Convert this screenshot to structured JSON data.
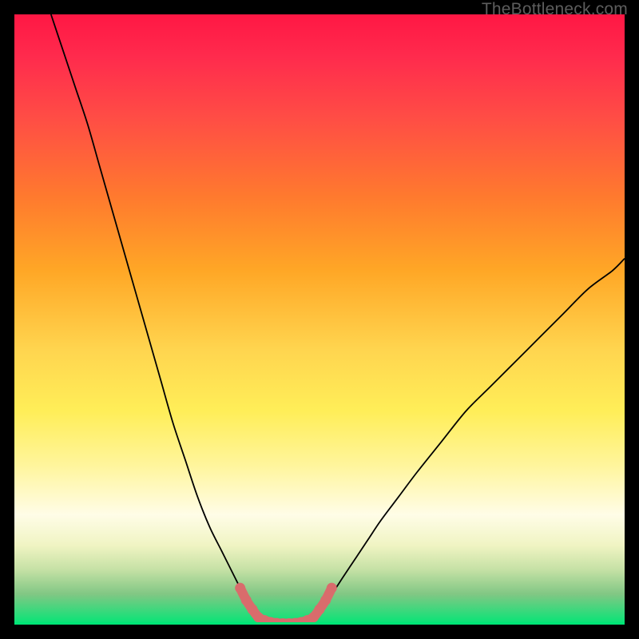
{
  "watermark": "TheBottleneck.com",
  "chart_data": {
    "type": "line",
    "title": "",
    "xlabel": "",
    "ylabel": "",
    "xlim": [
      0,
      100
    ],
    "ylim": [
      0,
      100
    ],
    "series": [
      {
        "name": "left-curve",
        "x": [
          6,
          8,
          10,
          12,
          14,
          16,
          18,
          20,
          22,
          24,
          26,
          28,
          30,
          32,
          34,
          36,
          37,
          38,
          39,
          40
        ],
        "values": [
          100,
          94,
          88,
          82,
          75,
          68,
          61,
          54,
          47,
          40,
          33,
          27,
          21,
          16,
          12,
          8,
          6,
          4,
          2.5,
          1.2
        ]
      },
      {
        "name": "bottom-segment",
        "x": [
          40,
          41,
          42,
          43,
          44,
          45,
          46,
          47,
          48,
          49
        ],
        "values": [
          1.2,
          0.7,
          0.4,
          0.25,
          0.2,
          0.2,
          0.25,
          0.4,
          0.7,
          1.2
        ]
      },
      {
        "name": "right-curve",
        "x": [
          49,
          50,
          52,
          54,
          56,
          58,
          60,
          63,
          66,
          70,
          74,
          78,
          82,
          86,
          90,
          94,
          98,
          100
        ],
        "values": [
          1.2,
          2.5,
          5,
          8,
          11,
          14,
          17,
          21,
          25,
          30,
          35,
          39,
          43,
          47,
          51,
          55,
          58,
          60
        ]
      }
    ],
    "highlight": {
      "name": "minimum-marker",
      "color": "#d96c6c",
      "x": [
        37,
        38,
        39,
        40,
        41,
        42,
        43,
        44,
        45,
        46,
        47,
        48,
        49,
        50,
        51,
        52
      ],
      "values": [
        6,
        4,
        2.5,
        1.2,
        0.7,
        0.4,
        0.25,
        0.2,
        0.2,
        0.25,
        0.4,
        0.7,
        1.2,
        2.5,
        4,
        6
      ]
    }
  }
}
